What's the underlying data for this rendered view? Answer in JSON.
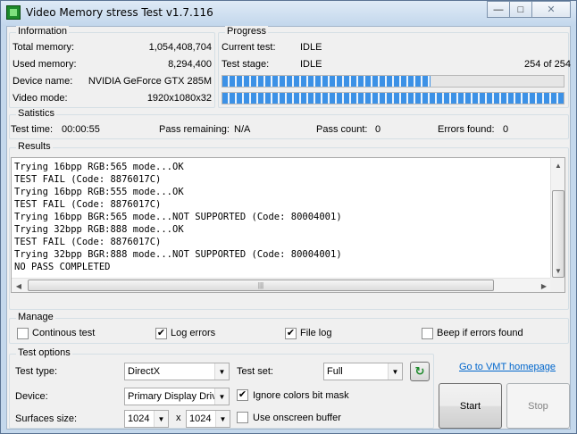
{
  "window": {
    "title": "Video Memory stress Test v1.7.116"
  },
  "information": {
    "label": "Information",
    "total_memory_label": "Total memory:",
    "total_memory": "1,054,408,704",
    "used_memory_label": "Used memory:",
    "used_memory": "8,294,400",
    "device_name_label": "Device name:",
    "device_name": "NVIDIA GeForce GTX 285M",
    "video_mode_label": "Video mode:",
    "video_mode": "1920x1080x32"
  },
  "progress": {
    "label": "Progress",
    "current_test_label": "Current test:",
    "current_test": "IDLE",
    "test_stage_label": "Test stage:",
    "test_stage": "IDLE",
    "stage_count": "254 of 254",
    "bar1_fraction": 0.61,
    "bar2_fraction": 1.0
  },
  "statistics": {
    "label": "Satistics",
    "test_time_label": "Test time:",
    "test_time": "00:00:55",
    "pass_remaining_label": "Pass remaining:",
    "pass_remaining": "N/A",
    "pass_count_label": "Pass count:",
    "pass_count": "0",
    "errors_found_label": "Errors found:",
    "errors_found": "0"
  },
  "results": {
    "label": "Results",
    "lines": [
      "Trying 16bpp RGB:565 mode...OK",
      "TEST FAIL (Code: 8876017C)",
      "Trying 16bpp RGB:555 mode...OK",
      "TEST FAIL (Code: 8876017C)",
      "Trying 16bpp BGR:565 mode...NOT SUPPORTED (Code: 80004001)",
      "Trying 32bpp RGB:888 mode...OK",
      "TEST FAIL (Code: 8876017C)",
      "Trying 32bpp BGR:888 mode...NOT SUPPORTED (Code: 80004001)",
      "NO PASS COMPLETED"
    ]
  },
  "manage": {
    "label": "Manage",
    "continous_test": "Continous test",
    "continous_test_checked": false,
    "log_errors": "Log errors",
    "log_errors_checked": true,
    "file_log": "File log",
    "file_log_checked": true,
    "beep_if_errors": "Beep if errors found",
    "beep_if_errors_checked": false
  },
  "test_options": {
    "label": "Test options",
    "test_type_label": "Test type:",
    "test_type": "DirectX",
    "test_set_label": "Test set:",
    "test_set": "Full",
    "device_label": "Device:",
    "device": "Primary Display Drive",
    "ignore_colors_label": "Ignore colors bit mask",
    "ignore_colors_checked": true,
    "surfaces_size_label": "Surfaces size:",
    "surface_w": "1024",
    "surface_x": "x",
    "surface_h": "1024",
    "onscreen_buffer_label": "Use onscreen buffer",
    "onscreen_buffer_checked": false
  },
  "actions": {
    "homepage_link": "Go to VMT homepage",
    "start": "Start",
    "stop": "Stop"
  }
}
